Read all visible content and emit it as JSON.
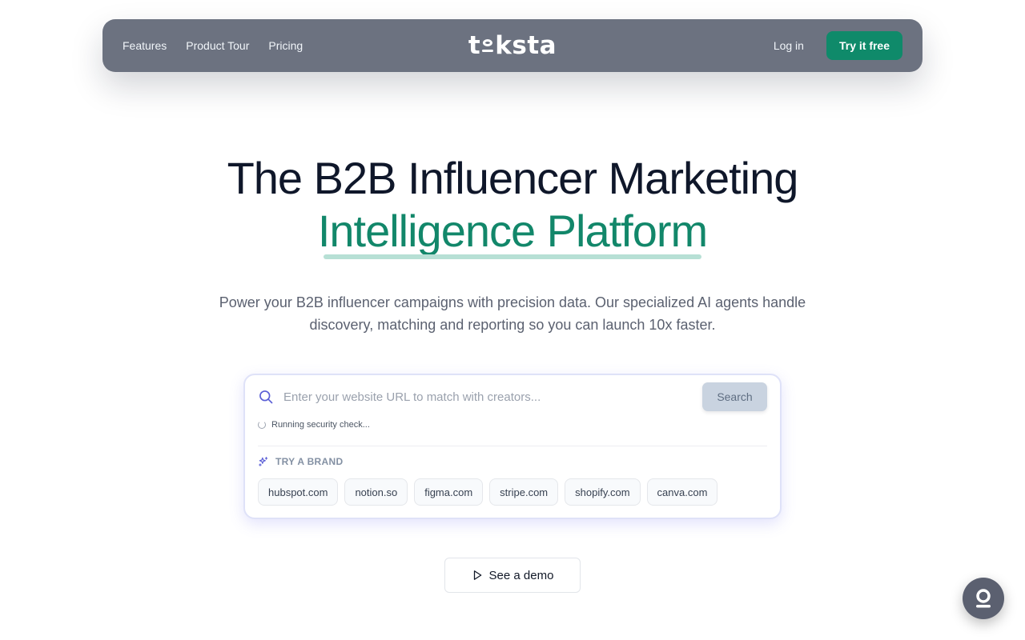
{
  "nav": {
    "links": [
      "Features",
      "Product Tour",
      "Pricing"
    ],
    "logo_text": {
      "start": "t",
      "end": "ksta"
    },
    "login_label": "Log in",
    "cta_label": "Try it free"
  },
  "hero": {
    "title_line1": "The B2B Influencer Marketing",
    "title_line2": "Intelligence Platform",
    "subtitle": "Power your B2B influencer campaigns with precision data. Our specialized AI agents handle discovery, matching and reporting so you can launch 10x faster."
  },
  "search": {
    "placeholder": "Enter your website URL to match with creators...",
    "value": "",
    "button_label": "Search",
    "status_text": "Running security check...",
    "brand_heading": "TRY A BRAND",
    "brands": [
      "hubspot.com",
      "notion.so",
      "figma.com",
      "stripe.com",
      "shopify.com",
      "canva.com"
    ]
  },
  "demo": {
    "label": "See a demo"
  },
  "icons": {
    "search": "search-icon",
    "sparkles": "sparkles-icon",
    "play": "play-icon",
    "chat": "chat-icon"
  },
  "colors": {
    "nav_bg": "#6c7280",
    "accent": "#0f8a6a",
    "title": "#0f172a",
    "title_accent": "#12876a"
  }
}
